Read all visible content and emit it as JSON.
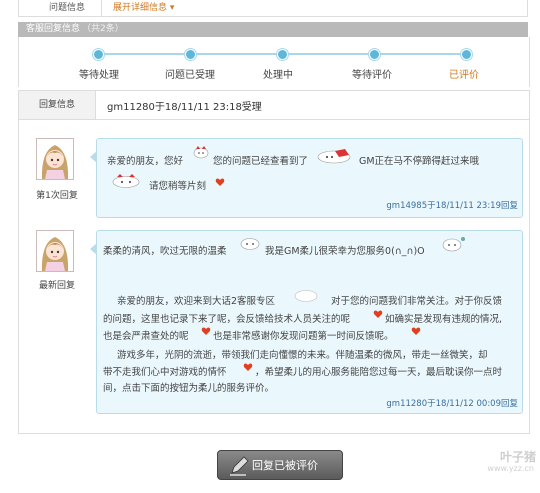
{
  "top": {
    "label": "问题信息",
    "link": "展开详细信息 ▾"
  },
  "header": {
    "title": "客服回复信息",
    "count": "（共2条）"
  },
  "progress": {
    "steps": [
      "等待处理",
      "问题已受理",
      "处理中",
      "等待评价",
      "已评价"
    ],
    "current": "已评价"
  },
  "info": {
    "key": "回复信息",
    "value": "gm11280于18/11/11 23:18受理"
  },
  "reply1": {
    "avatar_label": "第1次回复",
    "line1a": "亲爱的朋友，您好",
    "line1b": "您的问题已经查看到了",
    "line1c": "GM正在马不停蹄得赶过来哦",
    "line2": "请您稍等片刻",
    "signature": "gm14985于18/11/11 23:19回复"
  },
  "reply2": {
    "avatar_label": "最新回复",
    "line1a": "柔柔的清风，吹过无限的温柔",
    "line1b": "我是GM柔儿很荣幸为您服务0(∩_∩)O",
    "line2a": "亲爱的朋友，欢迎来到大话2客服专区",
    "line2b": "对于您的问题我们非常关注。对于你反馈",
    "line3a": "的问题，这里也记录下来了呢，会反馈给技术人员关注的呢",
    "line3b": "如确实是发现有违规的情况,",
    "line4a": "也是会严肃查处的呢",
    "line4b": "也是非常感谢你发现问题第一时间反馈呢。",
    "line5": "游戏多年，光阴的流逝，带领我们走向懂憬的未来。伴随温柔的微风，带走一丝微笑，却",
    "line6a": "带不走我们心中对游戏的情怀",
    "line6b": "，希望柔儿的用心服务能陪您过每一天，最后耽误你一点时",
    "line7": "间，点击下面的按钮为柔儿的服务评价。",
    "signature": "gm11280于18/11/12 00:09回复"
  },
  "button": {
    "label": "回复已被评价"
  },
  "watermark": {
    "main": "叶子猪",
    "sub": "www.yzz.cn"
  },
  "colors": {
    "accent": "#d07a20",
    "bubble": "#eaf7fc",
    "progress": "#5eb6d8"
  }
}
